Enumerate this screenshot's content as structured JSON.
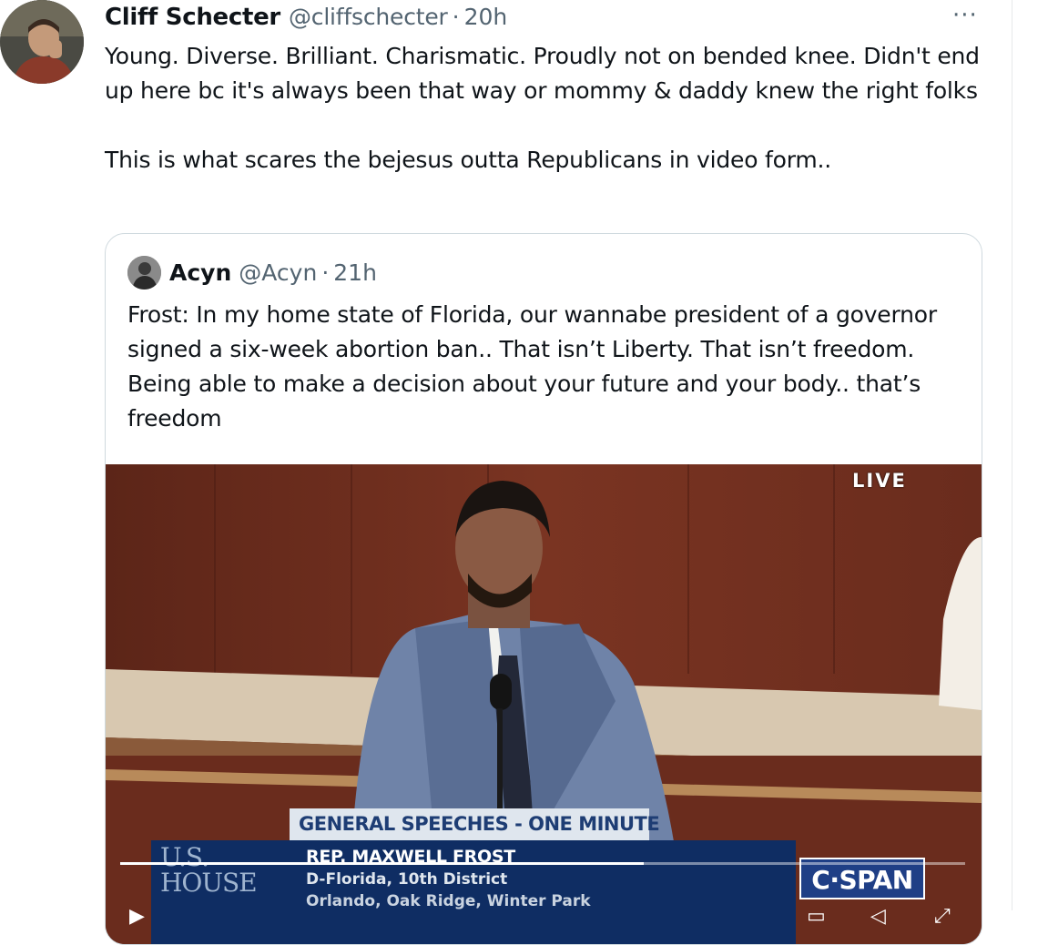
{
  "tweet": {
    "author_name": "Cliff Schecter",
    "author_handle": "@cliffschecter",
    "separator": "·",
    "time": "20h",
    "more_label": "···",
    "paragraphs": [
      "Young. Diverse. Brilliant. Charismatic. Proudly not on bended knee. Didn't end up here bc it's always been that way or mommy & daddy knew the right folks",
      "This is what scares the bejesus outta Republicans in video form.."
    ]
  },
  "quoted_tweet": {
    "author_name": "Acyn",
    "author_handle": "@Acyn",
    "separator": "·",
    "time": "21h",
    "text": "Frost: In my home state of Florida, our wannabe president of a governor signed a six-week abortion ban.. That isn’t Liberty. That isn’t freedom. Being able to make a decision about your future and your body.. that’s freedom"
  },
  "video": {
    "live_badge": "LIVE",
    "lower_third_title": "GENERAL SPEECHES - ONE MINUTE",
    "speaker_name": "REP. MAXWELL FROST",
    "speaker_district": "D-Florida, 10th District",
    "speaker_location": "Orlando, Oak Ridge, Winter Park",
    "house_logo_line1": "U.S.",
    "house_logo_line2": "HOUSE",
    "network_logo": "C·SPAN",
    "progress_fraction": 0.62,
    "colors": {
      "lower_third_bg": "#0f2d63",
      "lower_third_title_bg": "#dfe6ee",
      "lower_third_title_text": "#1e3d74",
      "cspan_bg": "#1f3f86"
    }
  },
  "icons": {
    "play": "play-icon",
    "volume": "volume-icon",
    "captions": "captions-icon",
    "fullscreen": "fullscreen-icon"
  }
}
